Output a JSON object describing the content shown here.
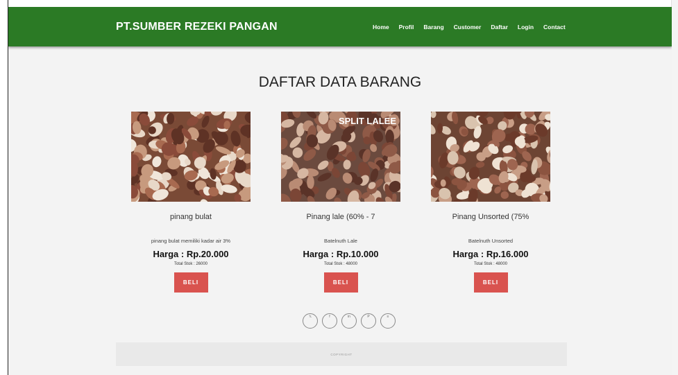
{
  "brand": "PT.SUMBER REZEKI PANGAN",
  "nav": [
    "Home",
    "Profil",
    "Barang",
    "Customer",
    "Daftar",
    "Login",
    "Contact"
  ],
  "page_title": "DAFTAR DATA BARANG",
  "products": [
    {
      "name": "pinang bulat",
      "desc": "pinang bulat memiliki kadar air 3%",
      "price": "Harga : Rp.20.000",
      "stok": "Total Stok : 26000",
      "buy": "BELI"
    },
    {
      "name": "Pinang lale (60% - 7",
      "desc": "Batelnuth Lale",
      "price": "Harga : Rp.10.000",
      "stok": "Total Stok : 48000",
      "buy": "BELI",
      "image_text": "SPLIT LALEE"
    },
    {
      "name": "Pinang Unsorted (75%",
      "desc": "Batelnuth Unsorted",
      "price": "Harga : Rp.16.000",
      "stok": "Total Stok : 48000",
      "buy": "BELI"
    }
  ],
  "social_icons": [
    "twitter-icon",
    "facebook-icon",
    "linkedin-icon",
    "pinterest-icon",
    "rss-icon"
  ],
  "footer": "COPYRIGHT",
  "colors": {
    "nav": "#2b7a25",
    "button": "#d9534f",
    "background": "#f3f3f3"
  }
}
